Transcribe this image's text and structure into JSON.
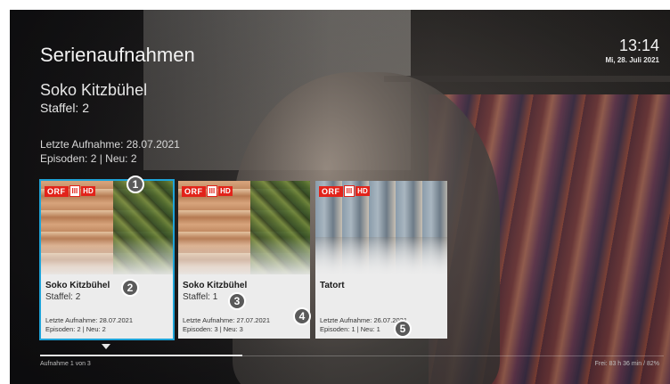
{
  "header": {
    "title": "Serienaufnahmen",
    "time": "13:14",
    "date": "Mi, 28. Juli 2021"
  },
  "selected_series": {
    "name": "Soko Kitzbühel",
    "season": "Staffel: 2",
    "last_recording": "Letzte Aufnahme: 28.07.2021",
    "episodes": "Episoden: 2 | Neu: 2"
  },
  "cards": [
    {
      "channel_logo": "ORF III HD",
      "logo_parts": [
        "ORF",
        "III",
        "HD"
      ],
      "title": "Soko Kitzbühel",
      "season": "Staffel: 2",
      "last_recording": "Letzte Aufnahme: 28.07.2021",
      "episodes": "Episoden: 2 | Neu: 2",
      "selected": true
    },
    {
      "channel_logo": "ORF III HD",
      "logo_parts": [
        "ORF",
        "III",
        "HD"
      ],
      "title": "Soko Kitzbühel",
      "season": "Staffel: 1",
      "last_recording": "Letzte Aufnahme: 27.07.2021",
      "episodes": "Episoden: 3 | Neu: 3",
      "selected": false
    },
    {
      "channel_logo": "ORF III HD",
      "logo_parts": [
        "ORF",
        "III",
        "HD"
      ],
      "title": "Tatort",
      "season": "",
      "last_recording": "Letzte Aufnahme: 26.07.2021",
      "episodes": "Episoden: 1 | Neu: 1",
      "selected": false
    }
  ],
  "badges": [
    "1",
    "2",
    "3",
    "4",
    "5"
  ],
  "footer": {
    "position_text": "Aufnahme 1 von 3",
    "storage_text": "Frei: 83 h 36 min / 82%",
    "progress_fraction": 0.33
  },
  "colors": {
    "selection_outline": "#1ea3d8",
    "orf_red": "#e2231a",
    "card_background": "#ececec"
  },
  "icons": [
    "scroll-down-arrow-icon"
  ]
}
